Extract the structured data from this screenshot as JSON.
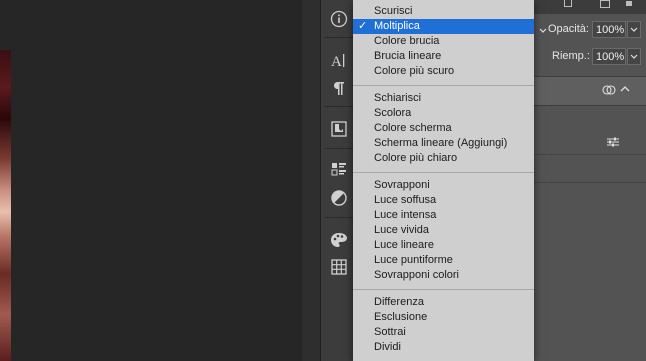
{
  "panel": {
    "opacity_label": "Opacità:",
    "opacity_value": "100%",
    "fill_label": "Riemp.:",
    "fill_value": "100%"
  },
  "blend_menu": {
    "selected": "Moltiplica",
    "groups": [
      [
        "Scurisci",
        "Moltiplica",
        "Colore brucia",
        "Brucia lineare",
        "Colore più scuro"
      ],
      [
        "Schiarisci",
        "Scolora",
        "Colore scherma",
        "Scherma lineare (Aggiungi)",
        "Colore più chiaro"
      ],
      [
        "Sovrapponi",
        "Luce soffusa",
        "Luce intensa",
        "Luce vivida",
        "Luce lineare",
        "Luce puntiforme",
        "Sovrapponi colori"
      ],
      [
        "Differenza",
        "Esclusione",
        "Sottrai",
        "Dividi"
      ]
    ]
  },
  "icons": {
    "info": "info-icon",
    "character": "character-icon",
    "paragraph": "paragraph-icon",
    "libraries": "libraries-icon",
    "properties": "properties-icon",
    "adjustments": "adjustments-icon",
    "color": "color-palette-icon",
    "swatches": "swatches-icon"
  },
  "colors": {
    "menu_bg": "#cfcfcf",
    "selection": "#1f6fd6",
    "panel_bg": "#535353",
    "workspace_bg": "#262626"
  }
}
